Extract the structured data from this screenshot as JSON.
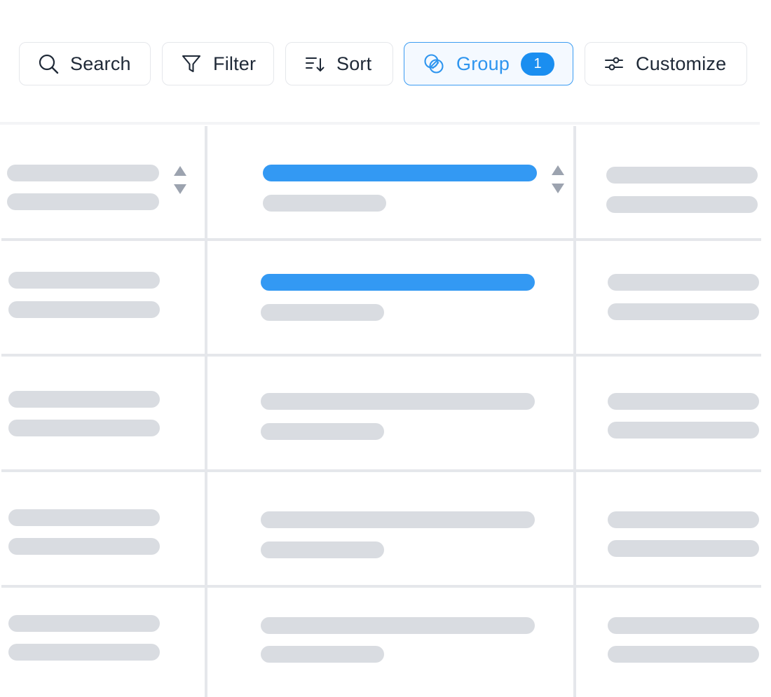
{
  "toolbar": {
    "search": {
      "label": "Search",
      "icon": "search-icon"
    },
    "filter": {
      "label": "Filter",
      "icon": "filter-icon"
    },
    "sort": {
      "label": "Sort",
      "icon": "sort-icon"
    },
    "group": {
      "label": "Group",
      "icon": "group-icon",
      "badge": "1",
      "active": true
    },
    "customize": {
      "label": "Customize",
      "icon": "sliders-icon"
    }
  },
  "colors": {
    "accent": "#2e95ef",
    "badge": "#1a8ef0",
    "placeholder": "#d9dce1",
    "highlight_bar": "#3399f3",
    "grid_line": "#e5e7eb"
  },
  "table": {
    "columns": 3,
    "rows": 5,
    "sortable_columns": [
      1,
      2
    ],
    "highlighted_rows_in_column_2": [
      1,
      2
    ],
    "content": "skeleton-placeholders"
  }
}
